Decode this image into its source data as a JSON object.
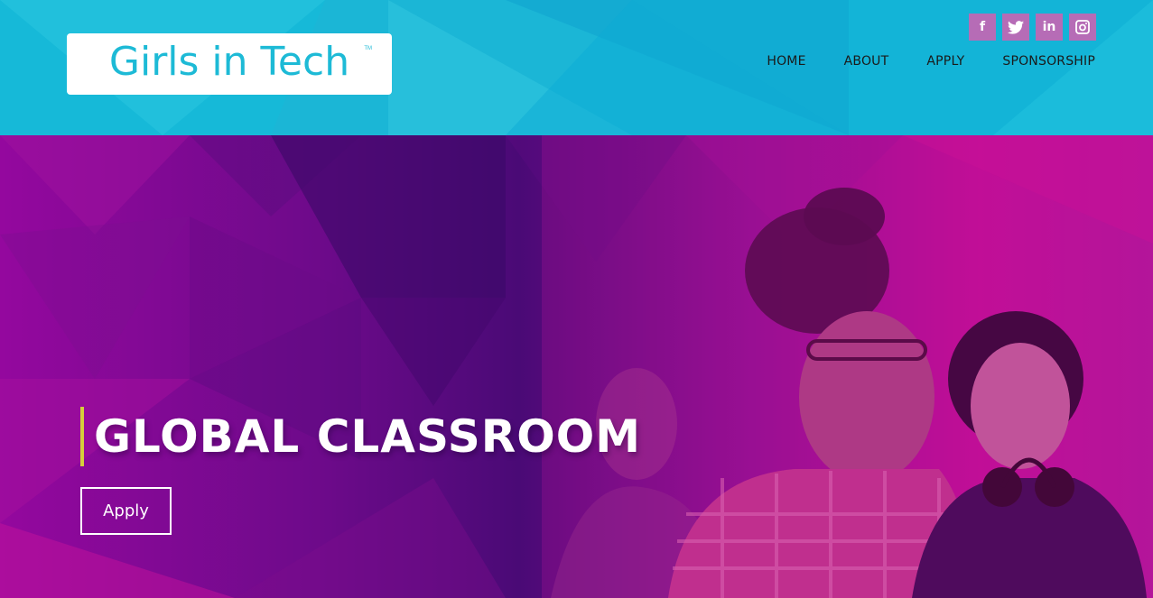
{
  "header": {
    "logo": {
      "text": "Girls in Tech",
      "tm": "TM"
    },
    "social": [
      {
        "icon": "facebook-icon",
        "glyph": "f"
      },
      {
        "icon": "twitter-icon",
        "glyph": "t"
      },
      {
        "icon": "linkedin-icon",
        "glyph": "in"
      },
      {
        "icon": "instagram-icon",
        "glyph": "◎"
      }
    ],
    "nav": [
      "HOME",
      "ABOUT",
      "APPLY",
      "SPONSORSHIP"
    ]
  },
  "hero": {
    "title": "GLOBAL CLASSROOM",
    "apply_label": "Apply"
  },
  "colors": {
    "header_bg": "#16b9d8",
    "logo_text": "#1dbad6",
    "social_bg": "#b66cb6",
    "hero_magenta": "#c20e96",
    "hero_purple": "#4a0a76",
    "accent_bar": "#d6cf3a"
  }
}
